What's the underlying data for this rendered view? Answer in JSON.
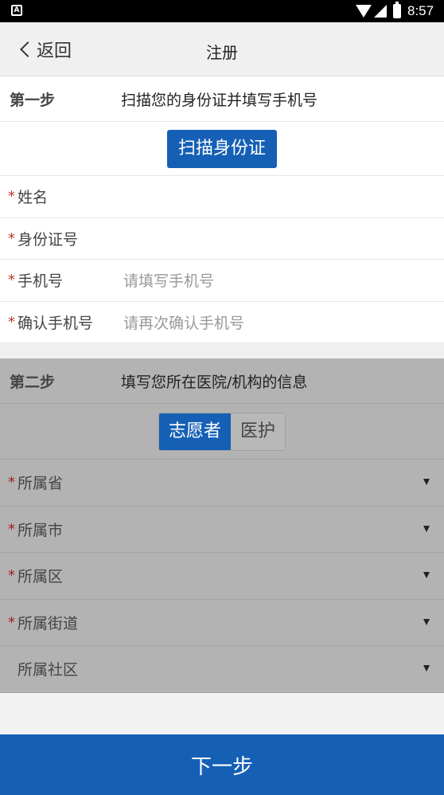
{
  "status": {
    "time": "8:57",
    "notify_glyph": "A"
  },
  "nav": {
    "back_label": "返回",
    "title": "注册"
  },
  "step1": {
    "label": "第一步",
    "desc": "扫描您的身份证并填写手机号",
    "scan_button": "扫描身份证",
    "fields": [
      {
        "required": "*",
        "label": "姓名",
        "placeholder": ""
      },
      {
        "required": "*",
        "label": "身份证号",
        "placeholder": ""
      },
      {
        "required": "*",
        "label": "手机号",
        "placeholder": "请填写手机号"
      },
      {
        "required": "*",
        "label": "确认手机号",
        "placeholder": "请再次确认手机号"
      }
    ]
  },
  "step2": {
    "label": "第二步",
    "desc": "填写您所在医院/机构的信息",
    "segments": [
      "志愿者",
      "医护"
    ],
    "selected_segment": "志愿者",
    "selects": [
      {
        "required": "*",
        "label": "所属省"
      },
      {
        "required": "*",
        "label": "所属市"
      },
      {
        "required": "*",
        "label": "所属区"
      },
      {
        "required": "*",
        "label": "所属街道"
      },
      {
        "required": "",
        "label": "所属社区"
      }
    ]
  },
  "next_button": "下一步",
  "colors": {
    "primary": "#1560b5",
    "required": "#c0392b",
    "overlay": "#b3b3b3"
  }
}
